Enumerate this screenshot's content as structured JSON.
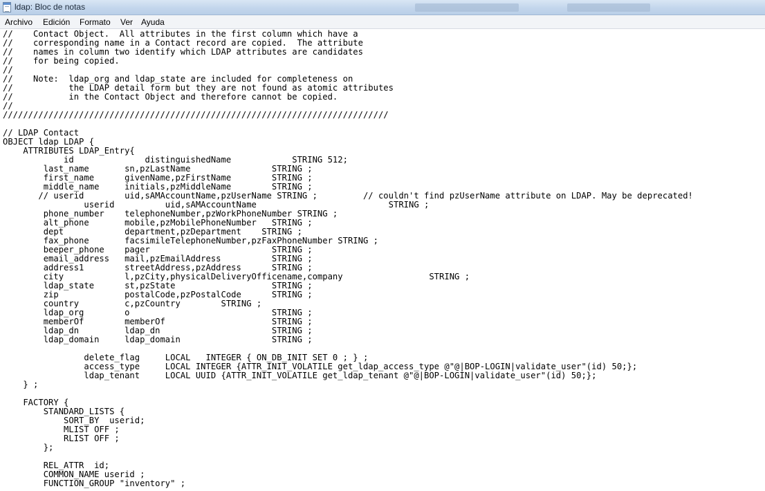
{
  "window": {
    "title": "ldap: Bloc de notas"
  },
  "menu": {
    "items": [
      "Archivo",
      "Edición",
      "Formato",
      "Ver",
      "Ayuda"
    ]
  },
  "editor": {
    "lines": [
      "//    Contact Object.  All attributes in the first column which have a",
      "//    corresponding name in a Contact record are copied.  The attribute",
      "//    names in column two identify which LDAP attributes are candidates",
      "//    for being copied.",
      "//",
      "//    Note:  ldap_org and ldap_state are included for completeness on",
      "//           the LDAP detail form but they are not found as atomic attributes",
      "//           in the Contact Object and therefore cannot be copied.",
      "//",
      "////////////////////////////////////////////////////////////////////////////",
      "",
      "// LDAP Contact",
      "OBJECT ldap LDAP {",
      "    ATTRIBUTES LDAP_Entry{",
      "            id              distinguishedName            STRING 512;",
      "        last_name       sn,pzLastName                STRING ;",
      "        first_name      givenName,pzFirstName        STRING ;",
      "        middle_name     initials,pzMiddleName        STRING ;",
      "       // userid        uid,sAMAccountName,pzUserName STRING ;         // couldn't find pzUserName attribute on LDAP. May be deprecated!",
      "                userid          uid,sAMAccountName                          STRING ;",
      "        phone_number    telephoneNumber,pzWorkPhoneNumber STRING ;",
      "        alt_phone       mobile,pzMobilePhoneNumber   STRING ;",
      "        dept            department,pzDepartment    STRING ;",
      "        fax_phone       facsimileTelephoneNumber,pzFaxPhoneNumber STRING ;",
      "        beeper_phone    pager                        STRING ;",
      "        email_address   mail,pzEmailAddress          STRING ;",
      "        address1        streetAddress,pzAddress      STRING ;",
      "        city            l,pzCity,physicalDeliveryOfficename,company                 STRING ;",
      "        ldap_state      st,pzState                   STRING ;",
      "        zip             postalCode,pzPostalCode      STRING ;",
      "        country         c,pzCountry        STRING ;",
      "        ldap_org        o                            STRING ;",
      "        memberOf        memberOf                     STRING ;",
      "        ldap_dn         ldap_dn                      STRING ;",
      "        ldap_domain     ldap_domain                  STRING ;",
      "",
      "                delete_flag     LOCAL   INTEGER { ON_DB_INIT SET 0 ; } ;",
      "                access_type     LOCAL INTEGER {ATTR_INIT_VOLATILE get_ldap_access_type @\"@|BOP-LOGIN|validate_user\"(id) 50;};",
      "                ldap_tenant     LOCAL UUID {ATTR_INIT_VOLATILE get_ldap_tenant @\"@|BOP-LOGIN|validate_user\"(id) 50;};",
      "    } ;",
      "",
      "    FACTORY {",
      "        STANDARD_LISTS {",
      "            SORT_BY  userid;",
      "            MLIST OFF ;",
      "            RLIST OFF ;",
      "        };",
      "",
      "        REL_ATTR  id;",
      "        COMMON_NAME userid ;",
      "        FUNCTION_GROUP \"inventory\" ;"
    ]
  }
}
